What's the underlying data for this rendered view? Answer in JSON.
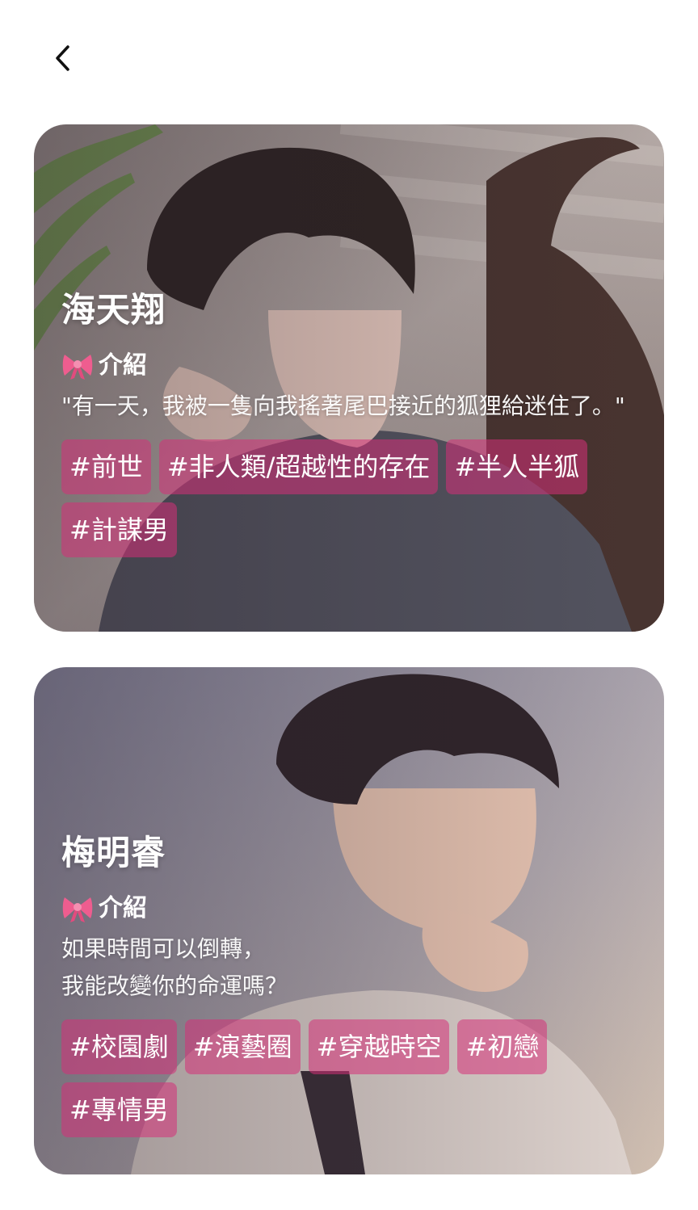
{
  "cards": [
    {
      "name": "海天翔",
      "intro_label": "介紹",
      "description": "\"有一天，我被一隻向我搖著尾巴接近的狐狸給迷住了。\"",
      "tags": [
        "#前世",
        "#非人類/超越性的存在",
        "#半人半狐",
        "#計謀男"
      ]
    },
    {
      "name": "梅明睿",
      "intro_label": "介紹",
      "description": "如果時間可以倒轉，\n我能改變你的命運嗎？",
      "tags": [
        "#校園劇",
        "#演藝圈",
        "#穿越時空",
        "#初戀",
        "#專情男"
      ]
    }
  ],
  "icons": {
    "back": "chevron-left-icon",
    "intro": "ribbon-bow-icon"
  },
  "colors": {
    "tag_bg": "#d63078",
    "text": "#ffffff"
  }
}
